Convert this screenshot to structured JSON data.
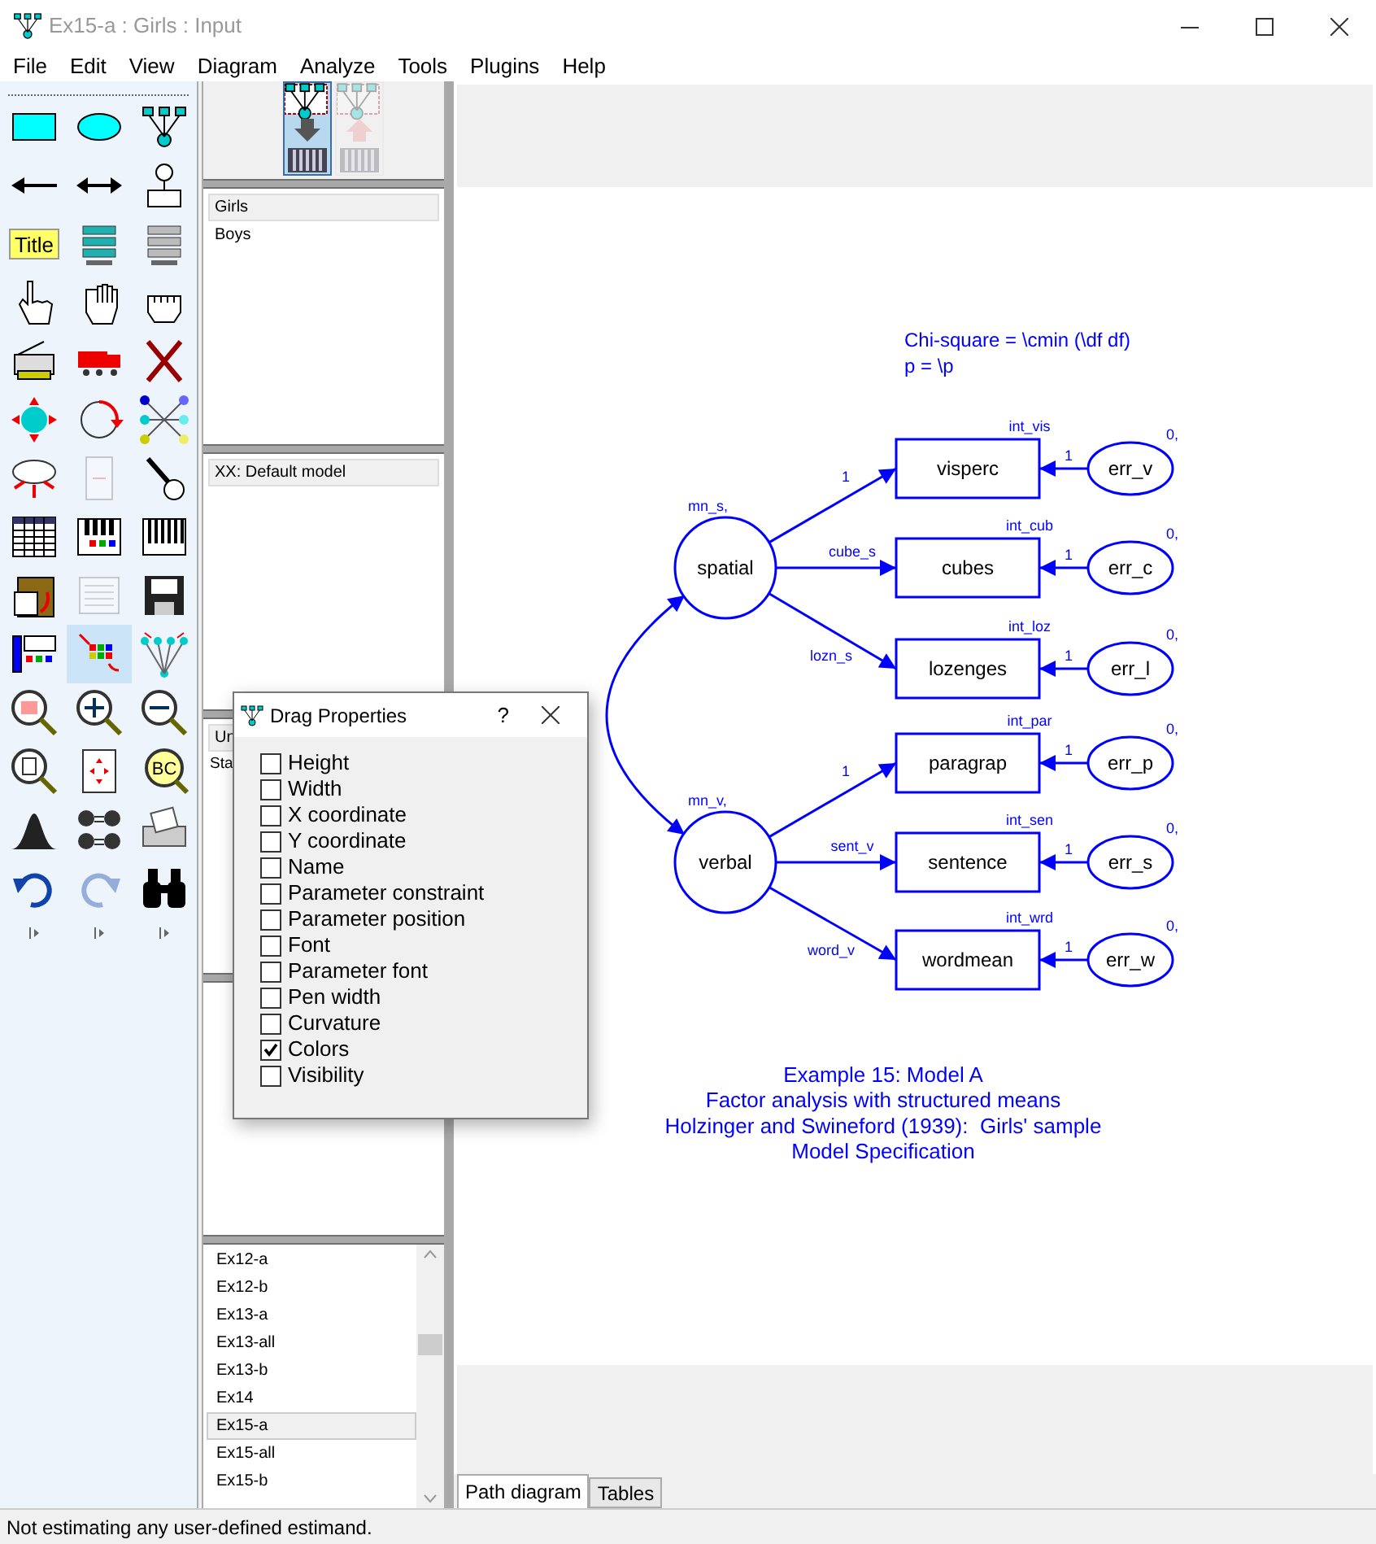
{
  "window": {
    "title": "Ex15-a : Girls : Input"
  },
  "menu": [
    "File",
    "Edit",
    "View",
    "Diagram",
    "Analyze",
    "Tools",
    "Plugins",
    "Help"
  ],
  "toolbar": [
    {
      "selected": false,
      "disabled": false
    },
    {
      "selected": false,
      "disabled": false
    },
    {
      "selected": false,
      "disabled": false
    },
    {
      "selected": false,
      "disabled": false
    },
    {
      "selected": false,
      "disabled": false
    },
    {
      "selected": false,
      "disabled": false
    },
    {
      "selected": false,
      "disabled": false,
      "label": "Title"
    },
    {
      "selected": false,
      "disabled": false
    },
    {
      "selected": false,
      "disabled": false
    },
    {
      "selected": false,
      "disabled": false
    },
    {
      "selected": false,
      "disabled": false
    },
    {
      "selected": false,
      "disabled": false
    },
    {
      "selected": false,
      "disabled": false
    },
    {
      "selected": false,
      "disabled": false
    },
    {
      "selected": false,
      "disabled": false
    },
    {
      "selected": false,
      "disabled": false
    },
    {
      "selected": false,
      "disabled": false
    },
    {
      "selected": false,
      "disabled": false
    },
    {
      "selected": false,
      "disabled": false
    },
    {
      "selected": false,
      "disabled": true
    },
    {
      "selected": false,
      "disabled": false
    },
    {
      "selected": false,
      "disabled": false
    },
    {
      "selected": false,
      "disabled": false
    },
    {
      "selected": false,
      "disabled": false
    },
    {
      "selected": false,
      "disabled": false
    },
    {
      "selected": false,
      "disabled": true
    },
    {
      "selected": false,
      "disabled": false
    },
    {
      "selected": false,
      "disabled": false
    },
    {
      "selected": true,
      "disabled": false
    },
    {
      "selected": false,
      "disabled": false
    },
    {
      "selected": false,
      "disabled": false
    },
    {
      "selected": false,
      "disabled": false
    },
    {
      "selected": false,
      "disabled": false
    },
    {
      "selected": false,
      "disabled": false
    },
    {
      "selected": false,
      "disabled": false
    },
    {
      "selected": false,
      "disabled": false,
      "label": "BC"
    },
    {
      "selected": false,
      "disabled": false
    },
    {
      "selected": false,
      "disabled": false
    },
    {
      "selected": false,
      "disabled": false
    },
    {
      "selected": false,
      "disabled": false
    },
    {
      "selected": false,
      "disabled": true
    },
    {
      "selected": false,
      "disabled": false
    }
  ],
  "model_buttons": [
    {
      "selected": true,
      "disabled": false
    },
    {
      "selected": false,
      "disabled": true
    }
  ],
  "groups": [
    {
      "label": "Girls",
      "selected": true
    },
    {
      "label": "Boys",
      "selected": false
    }
  ],
  "models": [
    {
      "label": "XX: Default model",
      "selected": true
    }
  ],
  "panel_3": {
    "header": "Un",
    "items": [
      "Sta"
    ]
  },
  "files": [
    {
      "label": "Ex12-a",
      "selected": false
    },
    {
      "label": "Ex12-b",
      "selected": false
    },
    {
      "label": "Ex13-a",
      "selected": false
    },
    {
      "label": "Ex13-all",
      "selected": false
    },
    {
      "label": "Ex13-b",
      "selected": false
    },
    {
      "label": "Ex14",
      "selected": false
    },
    {
      "label": "Ex15-a",
      "selected": true
    },
    {
      "label": "Ex15-all",
      "selected": false
    },
    {
      "label": "Ex15-b",
      "selected": false
    }
  ],
  "diagram": {
    "header": [
      "Chi-square = \\cmin (\\df df)",
      "p = \\p"
    ],
    "latent": [
      {
        "name": "spatial",
        "mean": "mn_s,",
        "indicators": [
          {
            "name": "visperc",
            "loading": "1",
            "intercept": "int_vis",
            "error": "err_v",
            "error_weight": "1",
            "error_mean": "0,"
          },
          {
            "name": "cubes",
            "loading": "cube_s",
            "intercept": "int_cub",
            "error": "err_c",
            "error_weight": "1",
            "error_mean": "0,"
          },
          {
            "name": "lozenges",
            "loading": "lozn_s",
            "intercept": "int_loz",
            "error": "err_l",
            "error_weight": "1",
            "error_mean": "0,"
          }
        ]
      },
      {
        "name": "verbal",
        "mean": "mn_v,",
        "indicators": [
          {
            "name": "paragrap",
            "loading": "1",
            "intercept": "int_par",
            "error": "err_p",
            "error_weight": "1",
            "error_mean": "0,"
          },
          {
            "name": "sentence",
            "loading": "sent_v",
            "intercept": "int_sen",
            "error": "err_s",
            "error_weight": "1",
            "error_mean": "0,"
          },
          {
            "name": "wordmean",
            "loading": "word_v",
            "intercept": "int_wrd",
            "error": "err_w",
            "error_weight": "1",
            "error_mean": "0,"
          }
        ]
      }
    ],
    "caption": [
      "Example 15: Model A",
      "Factor analysis with structured means",
      "Holzinger and Swineford (1939):  Girls' sample",
      "Model Specification"
    ]
  },
  "tabs": [
    {
      "label": "Path diagram",
      "selected": true
    },
    {
      "label": "Tables",
      "selected": false
    }
  ],
  "dialog": {
    "title": "Drag Properties",
    "help": "?",
    "options": [
      {
        "label": "Height",
        "checked": false
      },
      {
        "label": "Width",
        "checked": false
      },
      {
        "label": "X coordinate",
        "checked": false
      },
      {
        "label": "Y coordinate",
        "checked": false
      },
      {
        "label": "Name",
        "checked": false
      },
      {
        "label": "Parameter constraint",
        "checked": false
      },
      {
        "label": "Parameter position",
        "checked": false
      },
      {
        "label": "Font",
        "checked": false
      },
      {
        "label": "Parameter font",
        "checked": false
      },
      {
        "label": "Pen width",
        "checked": false
      },
      {
        "label": "Curvature",
        "checked": false
      },
      {
        "label": "Colors",
        "checked": true
      },
      {
        "label": "Visibility",
        "checked": false
      }
    ]
  },
  "status_bar": "Not estimating any user-defined estimand."
}
